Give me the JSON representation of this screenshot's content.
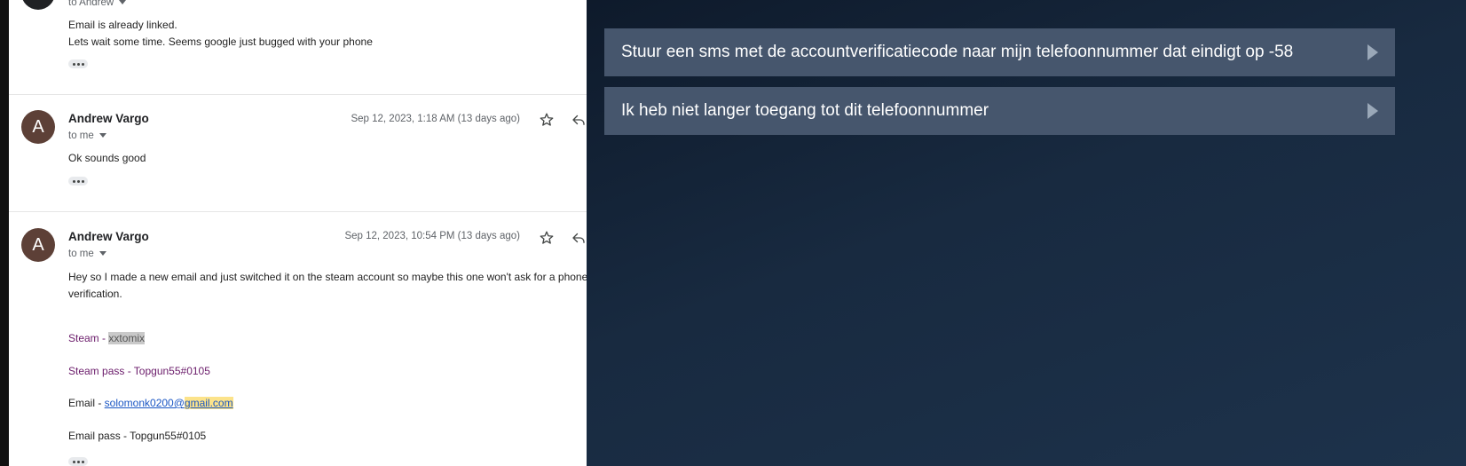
{
  "emails": [
    {
      "to_label": "to Andrew",
      "body": [
        "Email is already linked.",
        "Lets wait some time. Seems google just bugged with your phone"
      ]
    },
    {
      "avatar_letter": "A",
      "sender": "Andrew Vargo",
      "to_label": "to me",
      "date": "Sep 12, 2023, 1:18 AM (13 days ago)",
      "body": [
        "Ok sounds good"
      ]
    },
    {
      "avatar_letter": "A",
      "sender": "Andrew Vargo",
      "to_label": "to me",
      "date": "Sep 12, 2023, 10:54 PM (13 days ago)",
      "body": [
        "Hey so I made a new email and just switched it on the steam account so maybe this one won't ask for a phone",
        "verification."
      ],
      "details": {
        "steam_label": "Steam - ",
        "steam_user": "xxtomix",
        "steam_pass": "Steam pass - Topgun55#0105",
        "email_label": "Email - ",
        "email_local": "solomonk0200@",
        "email_domain": "gmail.com",
        "email_pass": "Email pass - Topgun55#0105"
      }
    }
  ],
  "steam": {
    "options": [
      "Stuur een sms met de accountverificatiecode naar mijn telefoonnummer dat eindigt op -58",
      "Ik heb niet langer toegang tot dit telefoonnummer"
    ]
  }
}
